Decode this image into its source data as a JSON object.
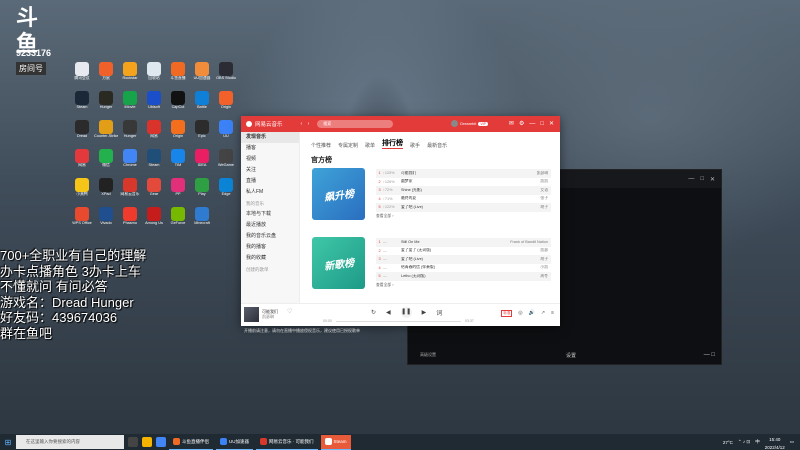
{
  "overlay": {
    "logo": "斗鱼",
    "room_label": "房间号",
    "room_id": "9233176",
    "lines": [
      "700+全职业有自己的理解",
      "办卡点播角色   3办卡上车",
      "不懂就问 有问必答",
      "游戏名：Dread Hunger",
      "好友码：439674036",
      "群在鱼吧"
    ]
  },
  "desktop_icons": [
    {
      "label": "腾讯会议",
      "color": "#e8e8f0"
    },
    {
      "label": "方鼠",
      "color": "#f0602a"
    },
    {
      "label": "Rockstar",
      "color": "#f3a41c"
    },
    {
      "label": "回收站",
      "color": "#dfe7ef"
    },
    {
      "label": "斗鱼直播",
      "color": "#f06a23"
    },
    {
      "label": "UU加速器",
      "color": "#f18d3a"
    },
    {
      "label": "OBS Studio",
      "color": "#2c2c35"
    },
    {
      "label": "Steam",
      "color": "#1b2838"
    },
    {
      "label": "Hunger",
      "color": "#2a2a22"
    },
    {
      "label": "iMovie",
      "color": "#16a34a"
    },
    {
      "label": "Ubisoft",
      "color": "#1b4ec9"
    },
    {
      "label": "CapCut",
      "color": "#111"
    },
    {
      "label": "Battle",
      "color": "#0f7fd8"
    },
    {
      "label": "Origin",
      "color": "#f3612b"
    },
    {
      "label": "Dread",
      "color": "#2b2b2b"
    },
    {
      "label": "Counter-Strike",
      "color": "#e39e17"
    },
    {
      "label": "Hunger",
      "color": "#383838"
    },
    {
      "label": "网易",
      "color": "#d9332b"
    },
    {
      "label": "Origin",
      "color": "#f36f1e"
    },
    {
      "label": "Epic",
      "color": "#2c2c2c"
    },
    {
      "label": "UU",
      "color": "#3b82f6"
    },
    {
      "label": "网易",
      "color": "#e4393c"
    },
    {
      "label": "微信",
      "color": "#23b14d"
    },
    {
      "label": "Chrome",
      "color": "#4285f4"
    },
    {
      "label": "Steam",
      "color": "#1f4e79"
    },
    {
      "label": "TIM",
      "color": "#1785e9"
    },
    {
      "label": "IDEA",
      "color": "#e91e63"
    },
    {
      "label": "WeGame",
      "color": "#444"
    },
    {
      "label": "小黄鸭",
      "color": "#f5c518"
    },
    {
      "label": "XPad",
      "color": "#222"
    },
    {
      "label": "网易云音乐",
      "color": "#d7382b"
    },
    {
      "label": "Gear",
      "color": "#e34a3b"
    },
    {
      "label": "PP",
      "color": "#e12f7a"
    },
    {
      "label": "Play",
      "color": "#2ea043"
    },
    {
      "label": "Edge",
      "color": "#0c84d6"
    },
    {
      "label": "WPS Office",
      "color": "#e84a2f"
    },
    {
      "label": "Vivado",
      "color": "#1f4f8f"
    },
    {
      "label": "Phasmo",
      "color": "#ef3b2d"
    },
    {
      "label": "Among Us",
      "color": "#c51c1c"
    },
    {
      "label": "GeForce",
      "color": "#76b900"
    },
    {
      "label": "Minecraft",
      "color": "#2f7bd0"
    },
    {
      "label": "",
      "color": "rgba(0,0,0,0)"
    }
  ],
  "music": {
    "app_title": "网易云音乐",
    "search_placeholder": "搜索",
    "username": "Dreambit",
    "vip": "VIP",
    "sidebar": [
      "发现音乐",
      "播客",
      "视频",
      "关注",
      "直播",
      "私人FM",
      "我的音乐",
      "本地与下载",
      "最近播放",
      "我的音乐云盘",
      "我的播客",
      "我的收藏",
      "创建的歌单"
    ],
    "tabs": [
      "个性推荐",
      "专属定制",
      "歌单",
      "排行榜",
      "歌手",
      "最新音乐"
    ],
    "active_tab": "排行榜",
    "section_title": "官方榜",
    "chart1_title": "飙升榜",
    "chart2_title": "新歌榜",
    "chart1_tracks": [
      {
        "no": "1",
        "trend": "↑125%",
        "name": "可能我们",
        "artist": "凯瑟琳"
      },
      {
        "no": "2",
        "trend": "↑126%",
        "name": "圆梦家",
        "artist": "凯凯"
      },
      {
        "no": "3",
        "trend": "↑72%",
        "name": "Shine (光影)",
        "artist": "艾语"
      },
      {
        "no": "4",
        "trend": "↑71%",
        "name": "最终的夏",
        "artist": "张子"
      },
      {
        "no": "5",
        "trend": "↑122%",
        "name": "爱了吧 (Live)",
        "artist": "胡子"
      }
    ],
    "chart2_tracks": [
      {
        "no": "1",
        "trend": "—",
        "name": "Still On Me",
        "artist": "Frank of Bandit Nation"
      },
      {
        "no": "2",
        "trend": "—",
        "name": "爱了爱了 (无词版)",
        "artist": "凯瑟"
      },
      {
        "no": "3",
        "trend": "—",
        "name": "爱了吧 (Live)",
        "artist": "胡子"
      },
      {
        "no": "4",
        "trend": "—",
        "name": "给青春的信 (伴奏版)",
        "artist": "小凯"
      },
      {
        "no": "5",
        "trend": "—",
        "name": "Letho (无词版)",
        "artist": "周冬"
      }
    ],
    "view_all": "查看全部 ›",
    "now_playing_title": "可能我们",
    "now_playing_artist": "凯瑟琳",
    "time_now": "00:00",
    "time_total": "03:37",
    "quality": "标准"
  },
  "dark_window": {
    "bottom_left": "高级设置",
    "bottom_mid": "设置",
    "controls": [
      "—",
      "□",
      "✕"
    ]
  },
  "subtitle": "开播前请注意，请勿在直播中播放侵权音乐，建议使用已授权歌单",
  "taskbar": {
    "search_placeholder": "在这里输入你要搜索的内容",
    "apps": [
      {
        "label": "斗鱼直播伴侣",
        "color": "#f06a23",
        "active": false
      },
      {
        "label": "UU加速器",
        "color": "#3b82f6",
        "active": false
      },
      {
        "label": "网易云音乐 · 可能我们",
        "color": "#d7382b",
        "active": false
      },
      {
        "label": "Steam",
        "color": "#ffffff",
        "active": true
      }
    ],
    "temp": "27°C",
    "lang": "中",
    "time": "15:40",
    "date": "2022/4/12"
  }
}
